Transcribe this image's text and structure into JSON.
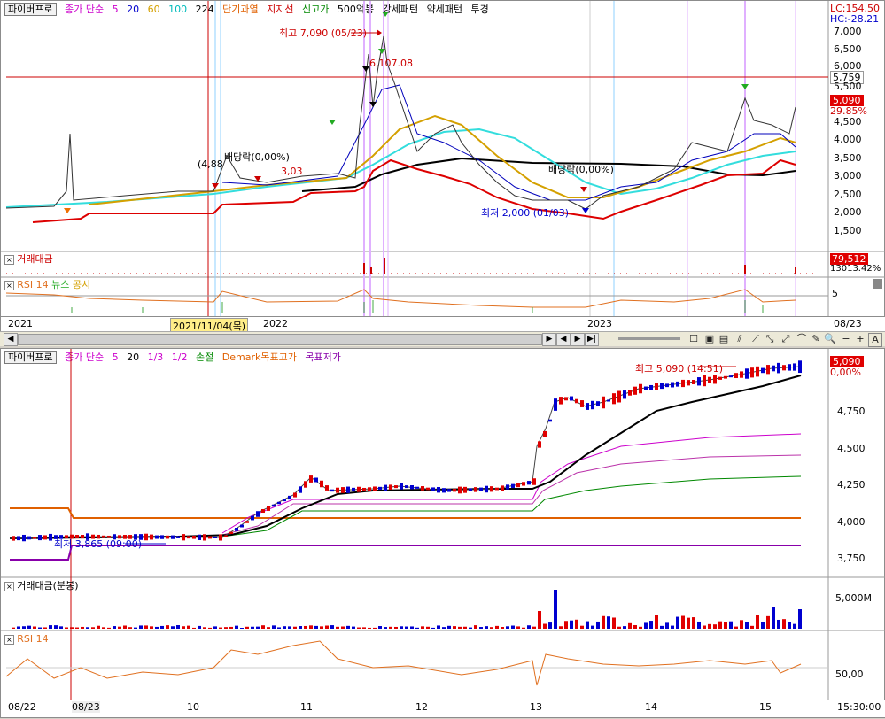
{
  "top": {
    "legend": {
      "name": "파이버프로",
      "ma_label": "종가 단순",
      "ma_periods": [
        "5",
        "20",
        "60",
        "100",
        "224"
      ],
      "ma_colors": [
        "#cc00cc",
        "#0000cc",
        "#d4a000",
        "#00cccc",
        "#000000"
      ],
      "overheat": "단기과열",
      "support": "지지선",
      "new_high": "신고가",
      "bong": "500억봉",
      "strong": "강세패턴",
      "weak": "약세패턴",
      "invest": "투경"
    },
    "price_axis": [
      "7,000",
      "6,500",
      "6,000",
      "5,500",
      "5,000",
      "4,500",
      "4,000",
      "3,500",
      "3,000",
      "2,500",
      "2,000",
      "1,500"
    ],
    "lc": "LC:154.50",
    "hc": "HC:-28.21",
    "ref_price": "5,759",
    "last_price": "5,090",
    "last_pct": "29.85%",
    "annotations": {
      "high": "최고 7,090 (05/23)",
      "high2": "6,107.08",
      "low": "최저 2,000 (01/03)",
      "div1": "배당락(0,00%)",
      "div2": "배당락(0,00%)",
      "price1": "(4,88",
      "price2": "3,03"
    },
    "vol_label": "거래대금",
    "vol_values": [
      "79,512",
      "13013.42%"
    ],
    "rsi_legend": {
      "rsi": "RSI 14",
      "news": "뉴스",
      "disclosure": "공시"
    },
    "rsi_axis": "5",
    "date_axis": [
      "2021",
      "2022",
      "2023",
      "08/23"
    ],
    "cursor_date": "2021/11/04(목)"
  },
  "bottom": {
    "legend": {
      "name": "파이버프로",
      "ma_label": "종가 단순",
      "ma_periods": [
        "5",
        "20"
      ],
      "ratios": [
        "1/3",
        "1/2"
      ],
      "stop": "손절",
      "demark_high": "Demark목표고가",
      "demark_low": "목표저가"
    },
    "price_axis": [
      "4,750",
      "4,500",
      "4,250",
      "4,000",
      "3,750"
    ],
    "last_price": "5,090",
    "last_pct": "0,00%",
    "high_annotation": "최고 5,090 (14:51)",
    "low_annotation": "최저 3,865 (09:00)",
    "vol_label": "거래대금(분봉)",
    "vol_axis": "5,000M",
    "rsi_label": "RSI 14",
    "rsi_axis": "50,00",
    "date_axis": [
      "08/22",
      "08/23",
      "10",
      "11",
      "12",
      "13",
      "14",
      "15",
      "15:30:00"
    ]
  },
  "toolbar_icons": [
    "scroll-left-icon",
    "scroll-right-icon",
    "zoom-slider",
    "checkbox-icon",
    "chart-toggle-icon",
    "zoom-in-icon",
    "zoom-out-icon",
    "search-icon",
    "minus-icon",
    "plus-icon",
    "auto-icon"
  ],
  "colors": {
    "up": "#e00000",
    "down": "#0000d0",
    "ref_line": "#cc0000",
    "rsi": "#e07020"
  }
}
